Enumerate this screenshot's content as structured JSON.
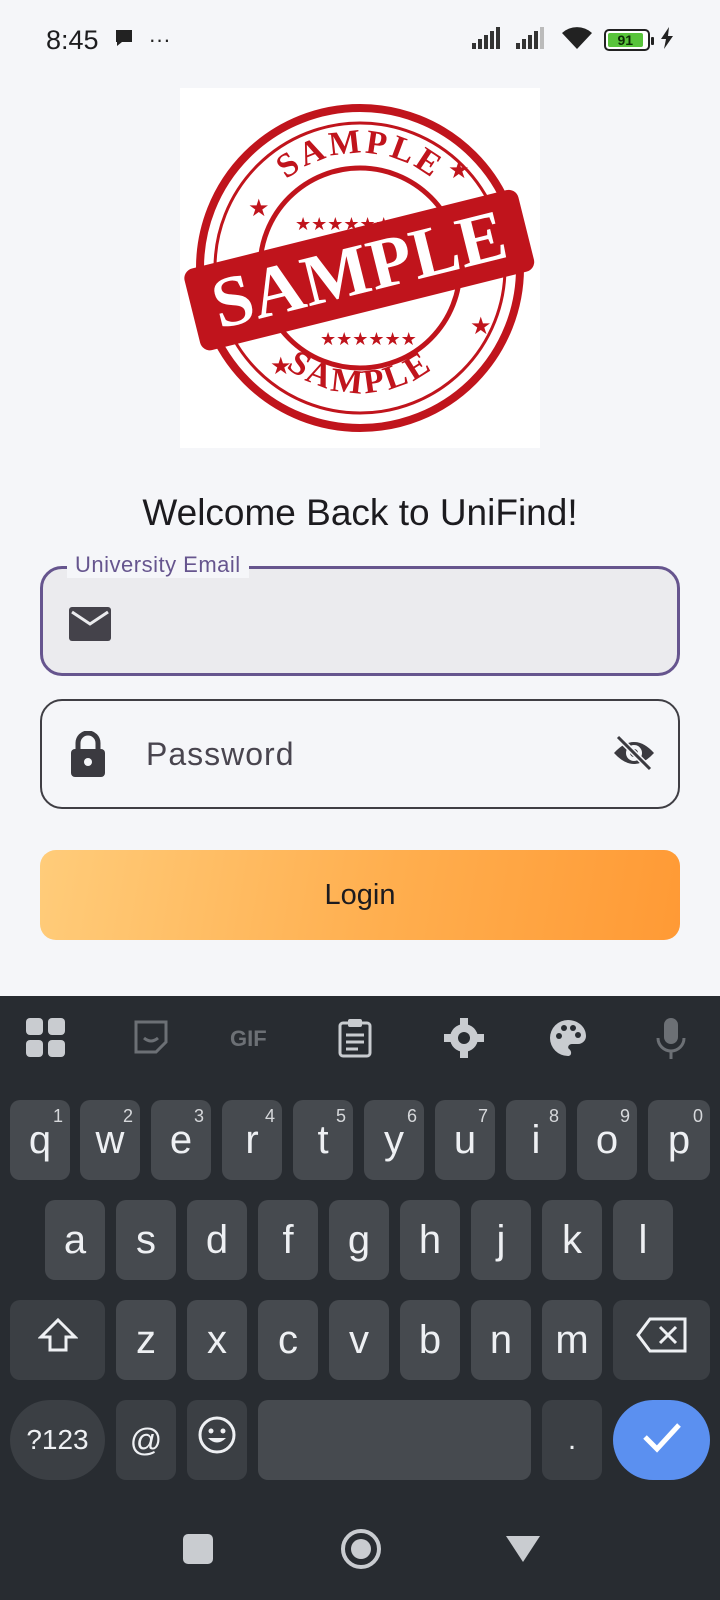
{
  "status_bar": {
    "time": "8:45",
    "more": "···",
    "battery_level": "91"
  },
  "logo": {
    "top_text": "SAMPLE",
    "center_text": "SAMPLE",
    "bottom_text": "SAMPLE"
  },
  "welcome": "Welcome Back to UniFind!",
  "email": {
    "label": "University Email",
    "value": ""
  },
  "password": {
    "placeholder": "Password"
  },
  "login_label": "Login",
  "keyboard": {
    "row1": [
      {
        "key": "q",
        "hint": "1"
      },
      {
        "key": "w",
        "hint": "2"
      },
      {
        "key": "e",
        "hint": "3"
      },
      {
        "key": "r",
        "hint": "4"
      },
      {
        "key": "t",
        "hint": "5"
      },
      {
        "key": "y",
        "hint": "6"
      },
      {
        "key": "u",
        "hint": "7"
      },
      {
        "key": "i",
        "hint": "8"
      },
      {
        "key": "o",
        "hint": "9"
      },
      {
        "key": "p",
        "hint": "0"
      }
    ],
    "row2": [
      "a",
      "s",
      "d",
      "f",
      "g",
      "h",
      "j",
      "k",
      "l"
    ],
    "row3": [
      "z",
      "x",
      "c",
      "v",
      "b",
      "n",
      "m"
    ],
    "symbols_label": "?123",
    "at_label": "@",
    "period_label": "."
  }
}
